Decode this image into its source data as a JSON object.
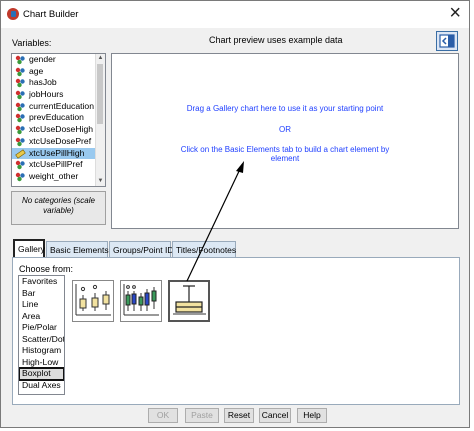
{
  "window": {
    "title": "Chart Builder"
  },
  "variables": {
    "label": "Variables:",
    "items": [
      {
        "name": "gender",
        "type": "nominal"
      },
      {
        "name": "age",
        "type": "nominal"
      },
      {
        "name": "hasJob",
        "type": "nominal"
      },
      {
        "name": "jobHours",
        "type": "nominal"
      },
      {
        "name": "currentEducation",
        "type": "nominal"
      },
      {
        "name": "prevEducation",
        "type": "nominal"
      },
      {
        "name": "xtcUseDoseHigh",
        "type": "nominal"
      },
      {
        "name": "xtcUseDosePref",
        "type": "nominal"
      },
      {
        "name": "xtcUsePillHigh",
        "type": "scale",
        "selected": true
      },
      {
        "name": "xtcUsePillPref",
        "type": "nominal"
      },
      {
        "name": "weight_other",
        "type": "nominal"
      }
    ],
    "no_categories_line1": "No categories (scale",
    "no_categories_line2": "variable)"
  },
  "preview_note": "Chart preview uses example data",
  "canvas": {
    "line1": "Drag a Gallery chart here to use it as your starting point",
    "line2": "OR",
    "line3": "Click on the Basic Elements tab to build a chart element by",
    "line4": "element"
  },
  "tabs": [
    "Gallery",
    "Basic Elements",
    "Groups/Point ID",
    "Titles/Footnotes"
  ],
  "gallery": {
    "choose_label": "Choose from:",
    "types": [
      "Favorites",
      "Bar",
      "Line",
      "Area",
      "Pie/Polar",
      "Scatter/Dot",
      "Histogram",
      "High-Low",
      "Boxplot",
      "Dual Axes"
    ],
    "selected_type": "Boxplot"
  },
  "buttons": {
    "ok": "OK",
    "paste": "Paste",
    "reset": "Reset",
    "cancel": "Cancel",
    "help": "Help"
  },
  "colors": {
    "accent_blue": "#1f3fff",
    "selection": "#99c9ef",
    "box_fill": "#f2e2a0",
    "box_green": "#3a9a5b",
    "box_blue": "#2a48c8"
  }
}
